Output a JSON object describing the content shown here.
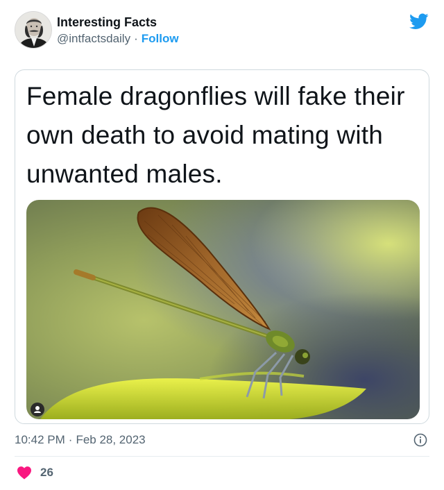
{
  "author": {
    "name": "Interesting Facts",
    "handle": "@intfactsdaily",
    "separator": "·",
    "follow_label": "Follow"
  },
  "card": {
    "text": "Female dragonflies will fake their own death to avoid mating with unwanted males."
  },
  "footer": {
    "time": "10:42 PM",
    "separator": "·",
    "date": "Feb 28, 2023"
  },
  "engagement": {
    "likes": "26"
  },
  "colors": {
    "accent": "#1d9bf0",
    "like": "#f91880",
    "muted_text": "#536471"
  },
  "icons": {
    "brand": "twitter-bird-icon",
    "info": "info-icon",
    "like": "heart-icon"
  }
}
